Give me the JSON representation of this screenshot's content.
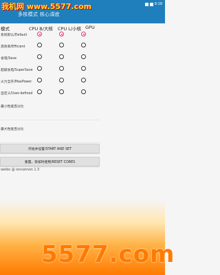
{
  "watermark_top": "我机网 www.5577.com",
  "status": {
    "time": "9:18"
  },
  "app_title": "多核模式 核心调度",
  "headers": {
    "mode": "模式",
    "cpu_big": "CPU B/大核",
    "cpu_little": "CPU L/小核",
    "gpu": "GPU"
  },
  "modes": [
    {
      "label": "系统默认/Default",
      "selected": true
    },
    {
      "label": "高效率/Efficient",
      "selected": false
    },
    {
      "label": "省电/Save",
      "selected": false
    },
    {
      "label": "超级省电/SuperSave",
      "selected": false
    },
    {
      "label": "火力全开/MaxPower",
      "selected": false
    },
    {
      "label": "自定义/User-defined",
      "selected": false
    }
  ],
  "min_perf_label": "最小性能百分比",
  "max_perf_label": "最大性能百分比",
  "buttons": {
    "start": "开始并设置/START AND SET",
    "reset": "重置，恢核时使用/RESET CORES"
  },
  "footer": "weibo @ ioncannon 1.3",
  "watermark_bottom": "5577.com",
  "colors": {
    "accent": "#1f7fbd",
    "radio_selected": "#e03060"
  }
}
